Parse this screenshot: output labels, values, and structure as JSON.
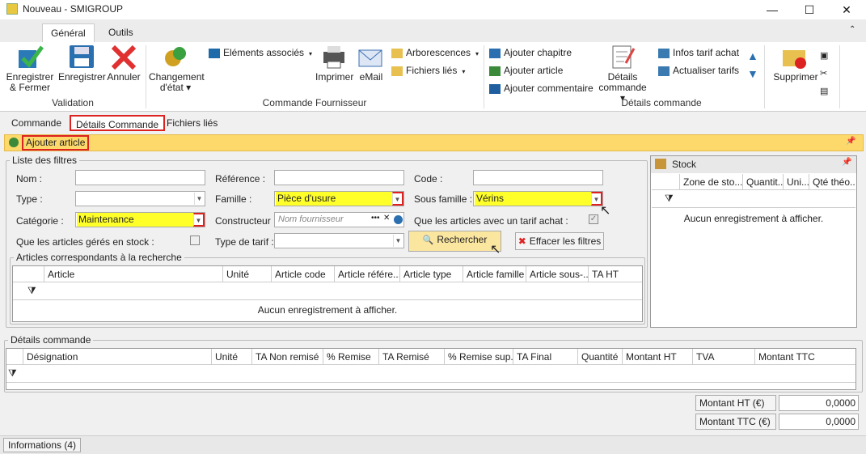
{
  "window": {
    "title": "Nouveau - SMIGROUP",
    "minimize": "—",
    "maximize": "☐",
    "close": "✕"
  },
  "ribbon_tabs": [
    "Général",
    "Outils"
  ],
  "ribbon": {
    "save_close": [
      "Enregistrer",
      "& Fermer"
    ],
    "save": "Enregistrer",
    "cancel": "Annuler",
    "change_state": [
      "Changement",
      "d'état ▾"
    ],
    "linked_elements": "Eléments associés",
    "print": "Imprimer",
    "email": "eMail",
    "trees": "Arborescences",
    "linked_files": "Fichiers liés",
    "add_chapter": "Ajouter chapitre",
    "add_article": "Ajouter article",
    "add_comment": "Ajouter commentaire",
    "order_details": [
      "Détails",
      "commande ▾"
    ],
    "tariff_info": "Infos tarif achat",
    "update_tariffs": "Actualiser tarifs",
    "delete": "Supprimer",
    "groups": {
      "validation": "Validation",
      "supplier_order": "Commande Fournisseur",
      "order_details": "Détails commande"
    }
  },
  "subtabs": [
    "Commande",
    "Détails Commande",
    "Fichiers liés"
  ],
  "toolbar": {
    "add_article": "Ajouter article"
  },
  "filters": {
    "legend": "Liste des filtres",
    "name_label": "Nom :",
    "reference_label": "Référence :",
    "code_label": "Code :",
    "type_label": "Type :",
    "family_label": "Famille :",
    "family_value": "Pièce d'usure",
    "subfamily_label": "Sous famille :",
    "subfamily_value": "Vérins",
    "category_label": "Catégorie :",
    "category_value": "Maintenance",
    "manufacturer_label": "Constructeur :",
    "manufacturer_placeholder": "Nom fournisseur",
    "tariff_only_label": "Que les articles avec un tarif achat :",
    "stock_only_label": "Que les articles gérés en stock :",
    "tariff_type_label": "Type de tarif :",
    "search_button": "Rechercher",
    "clear_button": "Effacer les filtres"
  },
  "results": {
    "legend": "Articles correspondants à la recherche",
    "columns": [
      "Article",
      "Unité",
      "Article code",
      "Article référe...",
      "Article type",
      "Article famille",
      "Article sous-...",
      "TA HT"
    ],
    "empty": "Aucun enregistrement à afficher."
  },
  "stock": {
    "title": "Stock",
    "columns": [
      "Zone de sto...",
      "Quantit...",
      "Uni...",
      "Qté théo..."
    ],
    "empty": "Aucun enregistrement à afficher."
  },
  "details": {
    "legend": "Détails commande",
    "columns": [
      "Désignation",
      "Unité",
      "TA Non remisé",
      "% Remise",
      "TA Remisé",
      "% Remise sup.",
      "TA Final",
      "Quantité",
      "Montant HT",
      "TVA",
      "Montant TTC"
    ]
  },
  "totals": {
    "ht_label": "Montant HT (€)",
    "ht_value": "0,0000",
    "ttc_label": "Montant TTC (€)",
    "ttc_value": "0,0000"
  },
  "status": {
    "info": "Informations (4)"
  }
}
